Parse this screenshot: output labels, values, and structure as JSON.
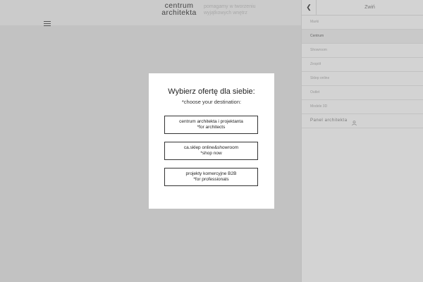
{
  "header": {
    "logo_line1": "centrum",
    "logo_line2": "architekta",
    "tagline_line1": "pomagamy w tworzeniu",
    "tagline_line2": "wyjątkowych wnętrz"
  },
  "side_panel": {
    "collapse_label": "Zwiń",
    "items": [
      {
        "label": "Marki"
      },
      {
        "label": "Centrum"
      },
      {
        "label": "Showroom"
      },
      {
        "label": "Zespół"
      },
      {
        "label": "Sklep online"
      },
      {
        "label": "Outlet"
      },
      {
        "label": "Modele 3D"
      }
    ],
    "active_item": "Centrum",
    "panel_label": "Panel architekta"
  },
  "modal": {
    "title": "Wybierz ofertę dla siebie:",
    "subtitle": "*choose your destination:",
    "options": [
      {
        "line1": "centrum architekta i projektanta",
        "line2": "*for architects"
      },
      {
        "line1": "ca.sklep online&showroom",
        "line2": "*shop now"
      },
      {
        "line1": "projekty komercyjne B2B",
        "line2": "*for professionals"
      }
    ]
  },
  "colors": {
    "overlay": "#c2c2c2",
    "modal_bg": "#ffffff",
    "panel_bg": "#d3d3d3"
  }
}
